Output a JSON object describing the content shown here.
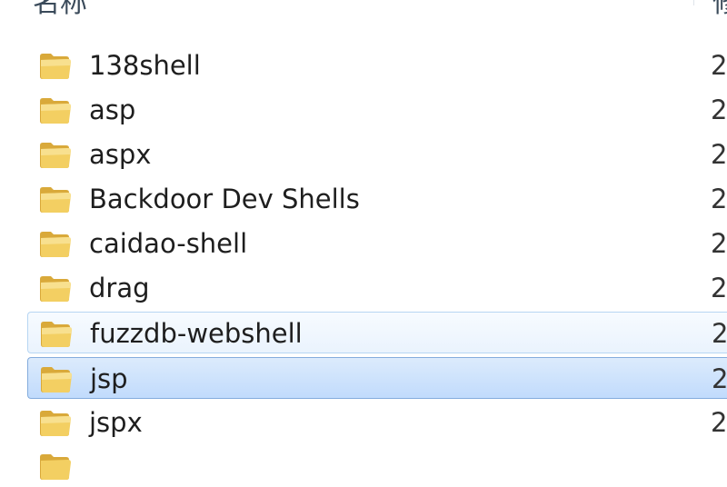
{
  "header": {
    "name_label": "名称",
    "modified_label": "修"
  },
  "rows": [
    {
      "name": "138shell",
      "date": "2"
    },
    {
      "name": "asp",
      "date": "2"
    },
    {
      "name": "aspx",
      "date": "2"
    },
    {
      "name": "Backdoor Dev Shells",
      "date": "2"
    },
    {
      "name": "caidao-shell",
      "date": "2"
    },
    {
      "name": "drag",
      "date": "2"
    },
    {
      "name": "fuzzdb-webshell",
      "date": "2",
      "state": "hover"
    },
    {
      "name": "jsp",
      "date": "2",
      "state": "selected"
    },
    {
      "name": "jspx",
      "date": "2"
    }
  ],
  "colors": {
    "folder_front": "#f3cf62",
    "folder_back": "#d9a93a",
    "selection": "#c1dbfc",
    "hover": "#eaf3fd"
  },
  "icon": "folder-icon"
}
